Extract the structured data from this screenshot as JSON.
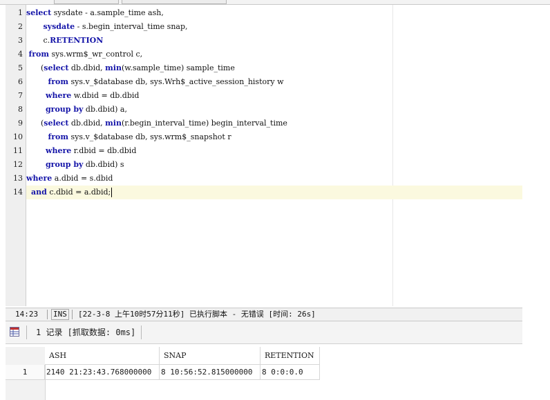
{
  "editor": {
    "line_numbers": [
      "1",
      "2",
      "3",
      "4",
      "5",
      "6",
      "7",
      "8",
      "9",
      "10",
      "11",
      "12",
      "13",
      "14"
    ],
    "lines": [
      [
        {
          "t": "select",
          "k": true
        },
        {
          "t": " sysdate - a.sample_time ash,"
        }
      ],
      [
        {
          "t": "       "
        },
        {
          "t": "sysdate",
          "k": true
        },
        {
          "t": " - s.begin_interval_time snap,"
        }
      ],
      [
        {
          "t": "       c."
        },
        {
          "t": "RETENTION",
          "k": true
        }
      ],
      [
        {
          "t": " "
        },
        {
          "t": "from",
          "k": true
        },
        {
          "t": " sys.wrm$_wr_control c,"
        }
      ],
      [
        {
          "t": "      ("
        },
        {
          "t": "select",
          "k": true
        },
        {
          "t": " db.dbid, "
        },
        {
          "t": "min",
          "k": true
        },
        {
          "t": "(w.sample_time) sample_time"
        }
      ],
      [
        {
          "t": "         "
        },
        {
          "t": "from",
          "k": true
        },
        {
          "t": " sys.v_$database db, sys.Wrh$_active_session_history w"
        }
      ],
      [
        {
          "t": "        "
        },
        {
          "t": "where",
          "k": true
        },
        {
          "t": " w.dbid = db.dbid"
        }
      ],
      [
        {
          "t": "        "
        },
        {
          "t": "group by",
          "k": true
        },
        {
          "t": " db.dbid) a,"
        }
      ],
      [
        {
          "t": "      ("
        },
        {
          "t": "select",
          "k": true
        },
        {
          "t": " db.dbid, "
        },
        {
          "t": "min",
          "k": true
        },
        {
          "t": "(r.begin_interval_time) begin_interval_time"
        }
      ],
      [
        {
          "t": "         "
        },
        {
          "t": "from",
          "k": true
        },
        {
          "t": " sys.v_$database db, sys.wrm$_snapshot r"
        }
      ],
      [
        {
          "t": "        "
        },
        {
          "t": "where",
          "k": true
        },
        {
          "t": " r.dbid = db.dbid"
        }
      ],
      [
        {
          "t": "        "
        },
        {
          "t": "group by",
          "k": true
        },
        {
          "t": " db.dbid) s"
        }
      ],
      [
        {
          "t": "where",
          "k": true
        },
        {
          "t": " a.dbid = s.dbid"
        }
      ],
      [
        {
          "t": "  "
        },
        {
          "t": "and",
          "k": true
        },
        {
          "t": " c.dbid = a.dbid;"
        }
      ]
    ],
    "current_line": 14,
    "keyword_color": "#1414a8",
    "current_line_color": "#fbf9df"
  },
  "statusbar": {
    "position": "14:23",
    "mode": "INS",
    "message": "[22-3-8 上午10时57分11秒] 已执行脚本 - 无错误  [时间: 26s]"
  },
  "results": {
    "icon": "grid-table-icon",
    "count_label": "1 记录 [抓取数据: 0ms]",
    "columns": [
      "ASH",
      "SNAP",
      "RETENTION"
    ],
    "rows": [
      {
        "num": "1",
        "cells": [
          "2140 21:23:43.768000000",
          "8 10:56:52.815000000",
          "8 0:0:0.0"
        ]
      }
    ]
  }
}
